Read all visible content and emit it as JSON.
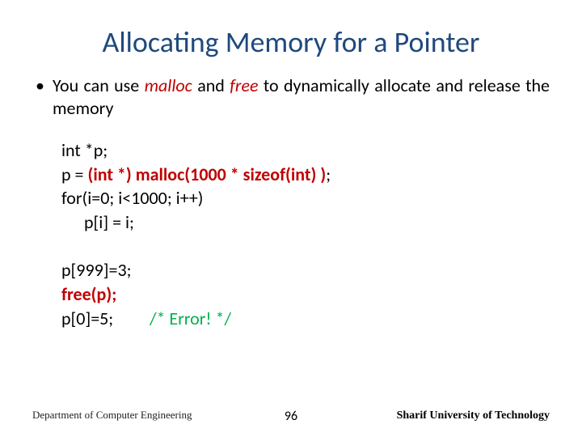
{
  "title": "Allocating Memory for a Pointer",
  "bullet": {
    "pre1": "You can use ",
    "malloc": "malloc",
    "mid1": " and ",
    "free": "free",
    "post1": " to dynamically allocate and release the memory"
  },
  "code": {
    "l1": "int *p;",
    "l2a": "p = ",
    "l2b": "(int *) malloc(1000 * sizeof(int) )",
    "l2c": ";",
    "l3": "for(i=0; i<1000; i++)",
    "l4": "p[i] = i;",
    "l5": "p[999]=3;",
    "l6": "free(p);",
    "l7a": "p[0]=5;",
    "l7b": "/* Error! */"
  },
  "footer": {
    "left": "Department of Computer Engineering",
    "center": "96",
    "right": "Sharif University of Technology"
  }
}
